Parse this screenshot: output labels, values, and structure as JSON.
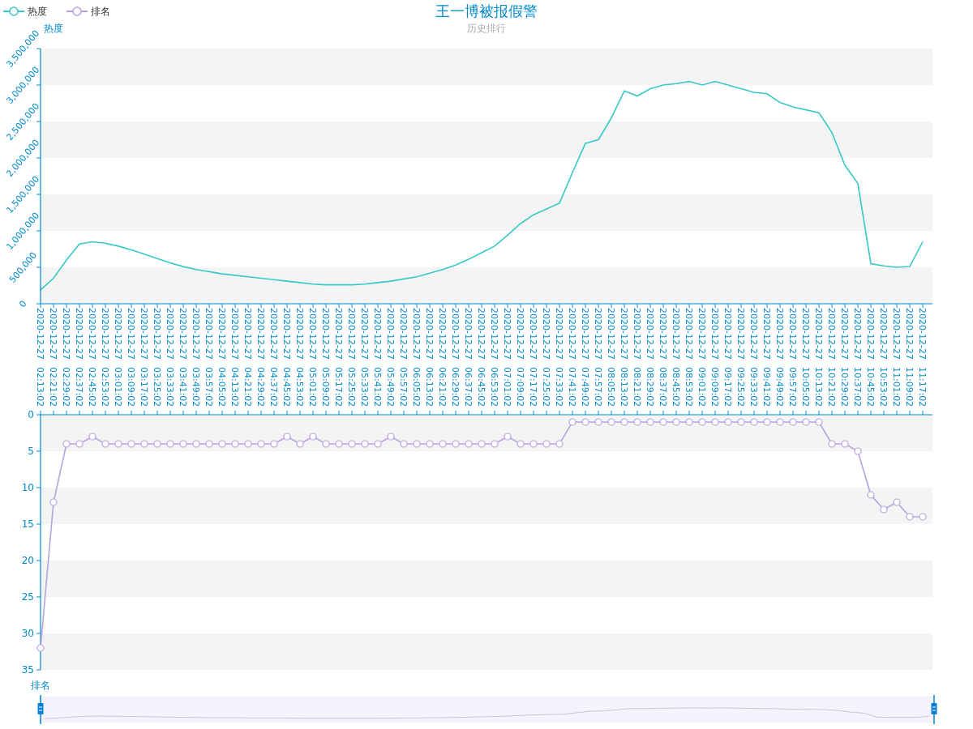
{
  "title": "王一博被报假警",
  "subtitle": "历史排行",
  "heat_chart": {
    "axis_name": "热度",
    "chart_data": {
      "type": "line",
      "categories": [
        "2020-12-27 02:13:02",
        "2020-12-27 02:21:02",
        "2020-12-27 02:29:02",
        "2020-12-27 02:37:02",
        "2020-12-27 02:45:02",
        "2020-12-27 02:53:02",
        "2020-12-27 03:01:02",
        "2020-12-27 03:09:02",
        "2020-12-27 03:17:02",
        "2020-12-27 03:25:02",
        "2020-12-27 03:33:02",
        "2020-12-27 03:41:02",
        "2020-12-27 03:49:02",
        "2020-12-27 03:57:02",
        "2020-12-27 04:05:02",
        "2020-12-27 04:13:02",
        "2020-12-27 04:21:02",
        "2020-12-27 04:29:02",
        "2020-12-27 04:37:02",
        "2020-12-27 04:45:02",
        "2020-12-27 04:53:02",
        "2020-12-27 05:01:02",
        "2020-12-27 05:09:02",
        "2020-12-27 05:17:02",
        "2020-12-27 05:25:02",
        "2020-12-27 05:33:02",
        "2020-12-27 05:41:02",
        "2020-12-27 05:49:02",
        "2020-12-27 05:57:02",
        "2020-12-27 06:05:02",
        "2020-12-27 06:13:02",
        "2020-12-27 06:21:02",
        "2020-12-27 06:29:02",
        "2020-12-27 06:37:02",
        "2020-12-27 06:45:02",
        "2020-12-27 06:53:02",
        "2020-12-27 07:01:02",
        "2020-12-27 07:09:02",
        "2020-12-27 07:17:02",
        "2020-12-27 07:25:02",
        "2020-12-27 07:33:02",
        "2020-12-27 07:41:02",
        "2020-12-27 07:49:02",
        "2020-12-27 07:57:02",
        "2020-12-27 08:05:02",
        "2020-12-27 08:13:02",
        "2020-12-27 08:21:02",
        "2020-12-27 08:29:02",
        "2020-12-27 08:37:02",
        "2020-12-27 08:45:02",
        "2020-12-27 08:53:02",
        "2020-12-27 09:01:02",
        "2020-12-27 09:09:02",
        "2020-12-27 09:17:02",
        "2020-12-27 09:25:02",
        "2020-12-27 09:33:02",
        "2020-12-27 09:41:02",
        "2020-12-27 09:49:02",
        "2020-12-27 09:57:02",
        "2020-12-27 10:05:02",
        "2020-12-27 10:13:02",
        "2020-12-27 10:21:02",
        "2020-12-27 10:29:02",
        "2020-12-27 10:37:02",
        "2020-12-27 10:45:02",
        "2020-12-27 10:53:02",
        "2020-12-27 11:01:02",
        "2020-12-27 11:09:02",
        "2020-12-27 11:17:02"
      ],
      "series": [
        {
          "name": "热度",
          "color": "#37c8c8",
          "values": [
            190000,
            350000,
            600000,
            820000,
            850000,
            830000,
            790000,
            740000,
            680000,
            620000,
            560000,
            510000,
            470000,
            440000,
            410000,
            390000,
            370000,
            350000,
            330000,
            310000,
            290000,
            270000,
            260000,
            260000,
            260000,
            270000,
            290000,
            310000,
            340000,
            370000,
            420000,
            470000,
            530000,
            610000,
            700000,
            790000,
            940000,
            1100000,
            1220000,
            1300000,
            1380000,
            1800000,
            2200000,
            2250000,
            2550000,
            2920000,
            2850000,
            2950000,
            3000000,
            3020000,
            3050000,
            3000000,
            3050000,
            3000000,
            2950000,
            2900000,
            2880000,
            2760000,
            2700000,
            2660000,
            2620000,
            2350000,
            1900000,
            1650000,
            550000,
            520000,
            500000,
            510000,
            850000
          ]
        }
      ],
      "ylim": [
        0,
        3500000
      ],
      "yticks": [
        {
          "value": 0,
          "label": "0"
        },
        {
          "value": 500000,
          "label": "500,000"
        },
        {
          "value": 1000000,
          "label": "1,000,000"
        },
        {
          "value": 1500000,
          "label": "1,500,000"
        },
        {
          "value": 2000000,
          "label": "2,000,000"
        },
        {
          "value": 2500000,
          "label": "2,500,000"
        },
        {
          "value": 3000000,
          "label": "3,000,000"
        },
        {
          "value": 3500000,
          "label": "3,500,000"
        }
      ]
    }
  },
  "rank_chart": {
    "axis_name": "排名",
    "chart_data": {
      "type": "line",
      "series": [
        {
          "name": "排名",
          "color": "#b6a2de",
          "marker": "circle",
          "values": [
            32,
            12,
            4,
            4,
            3,
            4,
            4,
            4,
            4,
            4,
            4,
            4,
            4,
            4,
            4,
            4,
            4,
            4,
            4,
            3,
            4,
            3,
            4,
            4,
            4,
            4,
            4,
            3,
            4,
            4,
            4,
            4,
            4,
            4,
            4,
            4,
            3,
            4,
            4,
            4,
            4,
            1,
            1,
            1,
            1,
            1,
            1,
            1,
            1,
            1,
            1,
            1,
            1,
            1,
            1,
            1,
            1,
            1,
            1,
            1,
            1,
            4,
            4,
            5,
            11,
            13,
            12,
            14,
            14
          ]
        }
      ],
      "ylim": [
        35,
        0
      ],
      "yticks": [
        0,
        5,
        10,
        15,
        20,
        25,
        30,
        35
      ]
    }
  },
  "range_slider": {
    "level": 1
  }
}
